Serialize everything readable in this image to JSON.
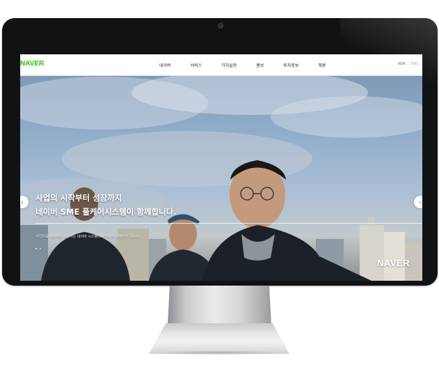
{
  "site": {
    "logo": "NAVER",
    "nav": [
      {
        "label": "네이버"
      },
      {
        "label": "서비스"
      },
      {
        "label": "가치실현"
      },
      {
        "label": "홍보"
      },
      {
        "label": "투자정보"
      },
      {
        "label": "채용"
      }
    ],
    "lang": {
      "kor": "KOR",
      "eng": "ENG",
      "separator": "|"
    }
  },
  "hero": {
    "title_line1": "사업의 시작부터 성장까지",
    "title_line2": "네이버 SME 풀케어시스템이 함께합니다.",
    "description": "사업자를 지원하고 응원하는 네이버 시스템이 사장님의 경쟁력이 됩니다",
    "watermark": "NAVER",
    "arrow_prev": "‹",
    "arrow_next": "›",
    "slide_count": 2,
    "active_slide": 1
  },
  "colors": {
    "brand_green": "#1ec800",
    "bezel": "#111214"
  },
  "icons": {
    "apple": "apple-logo-icon",
    "camera": "camera-icon"
  }
}
